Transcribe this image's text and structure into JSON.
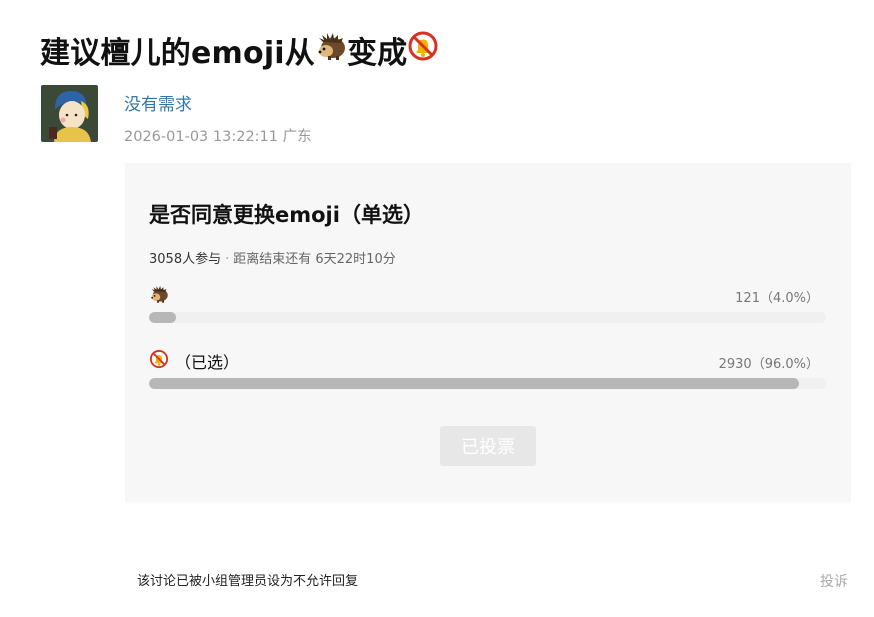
{
  "post": {
    "title": "建议檀儿的emoji从🦔变成🔕",
    "title_parts": {
      "prefix": "建议檀儿的emoji从",
      "middle": "变成"
    },
    "author": "没有需求",
    "datetime_location": "2026-01-03 13:22:11 广东"
  },
  "poll": {
    "title": "是否同意更换emoji（单选）",
    "participants": "3058人参与",
    "separator": "·",
    "ends_in": "距离结束还有 6天22时10分",
    "options": [
      {
        "icon": "hedgehog-icon",
        "label": "",
        "count_text": "121（4.0%）",
        "percent": 4.0
      },
      {
        "icon": "muted-bell-icon",
        "label": "（已选）",
        "count_text": "2930（96.0%）",
        "percent": 96.0
      }
    ],
    "button_label": "已投票"
  },
  "footer": {
    "notice": "该讨论已被小组管理员设为不允许回复",
    "report": "投诉"
  },
  "colors": {
    "author_link": "#3377aa",
    "poll_bg": "#f7f7f7",
    "bar_fill": "#b7b7b7",
    "button_bg": "#e7e7e7"
  }
}
